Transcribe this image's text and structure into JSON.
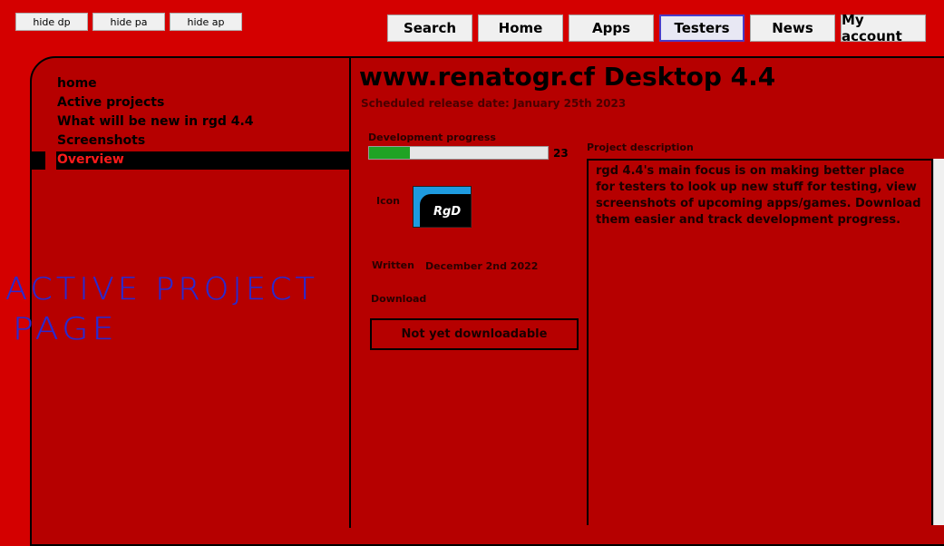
{
  "top_buttons": {
    "hide_dp": "hide dp",
    "hide_pa": "hide pa",
    "hide_ap": "hide ap"
  },
  "nav": {
    "search": "Search",
    "home": "Home",
    "apps": "Apps",
    "testers": "Testers",
    "news": "News",
    "account": "My account",
    "active": "Testers"
  },
  "sidebar": {
    "items": [
      {
        "label": "home"
      },
      {
        "label": "Active projects"
      },
      {
        "label": "What will be new in rgd 4.4"
      },
      {
        "label": "Screenshots"
      },
      {
        "label": "Overview",
        "active": true
      }
    ]
  },
  "annotation": {
    "line1": "ACTIVE PROJECT",
    "line2": "PAGE"
  },
  "project": {
    "title": "www.renatogr.cf Desktop 4.4",
    "release_date": "Scheduled release date: January 25th 2023",
    "progress_label": "Development progress",
    "progress_value": 23,
    "progress_text": "23",
    "icon_label": "Icon",
    "icon_text": "RgD",
    "written_label": "Written",
    "written_date": "December 2nd 2022",
    "download_label": "Download",
    "download_button": "Not yet downloadable",
    "description_label": "Project description",
    "description": "rgd 4.4's main focus is on making better place for testers to look up new stuff for testing, view screenshots of upcoming apps/games. Download them easier and track development progress."
  },
  "colors": {
    "background": "#d40000",
    "panel": "#b60000",
    "progress": "#1fa324",
    "handwriting": "#2a2ad0",
    "active_nav_border": "#4a3cc8"
  }
}
